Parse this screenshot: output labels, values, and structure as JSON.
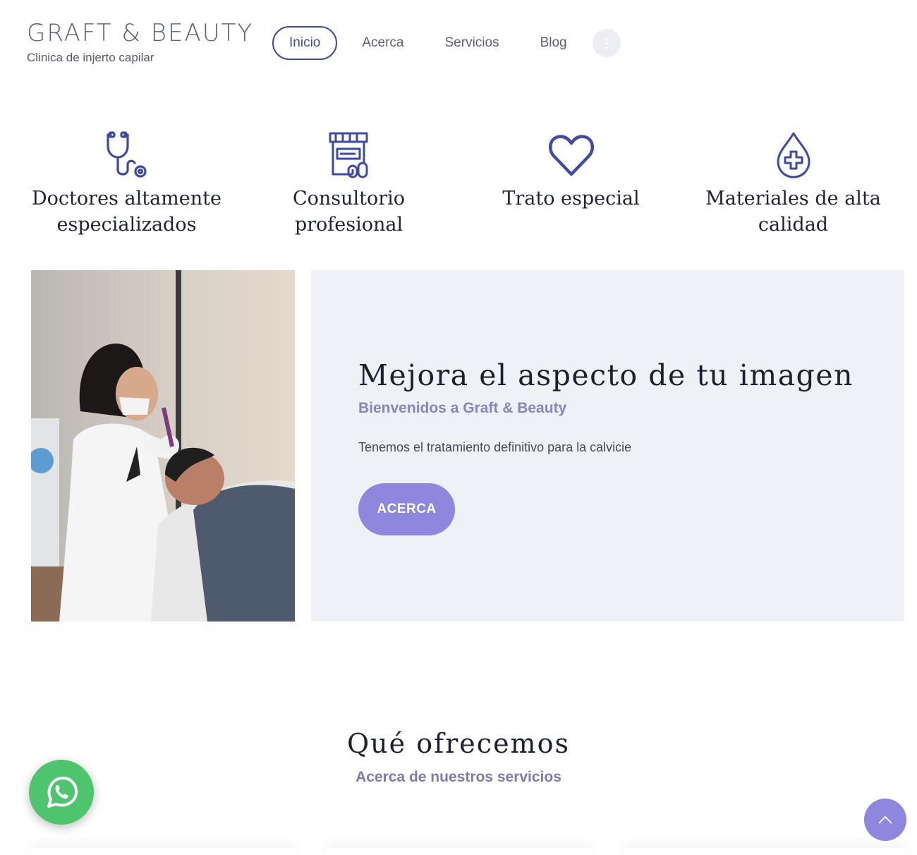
{
  "brand": {
    "title": "GRAFT & BEAUTY",
    "subtitle": "Clinica de injerto capilar"
  },
  "nav": {
    "items": [
      {
        "label": "Inicio",
        "active": true
      },
      {
        "label": "Acerca"
      },
      {
        "label": "Servicios"
      },
      {
        "label": "Blog"
      }
    ],
    "more_icon": "vertical-dots-icon"
  },
  "features": [
    {
      "icon": "stethoscope-icon",
      "label": "Doctores altamente especializados"
    },
    {
      "icon": "pharmacy-icon",
      "label": "Consultorio profesional"
    },
    {
      "icon": "heart-icon",
      "label": "Trato especial"
    },
    {
      "icon": "drop-plus-icon",
      "label": "Materiales de alta calidad"
    }
  ],
  "hero": {
    "title": "Mejora el aspecto de tu imagen",
    "subtitle": "Bienvenidos a Graft & Beauty",
    "text": "Tenemos el tratamiento definitivo para la calvicie",
    "button": "ACERCA"
  },
  "section": {
    "title": "Qué ofrecemos",
    "subtitle": "Acerca de nuestros servicios"
  },
  "floating": {
    "whatsapp_icon": "whatsapp-icon",
    "top_icon": "chevron-up-icon"
  },
  "colors": {
    "accent": "#8f86dd",
    "nav_active": "#3f4aa0",
    "icon": "#3f4aa0",
    "panel": "#eef1f5",
    "whatsapp": "#4fc46f"
  }
}
